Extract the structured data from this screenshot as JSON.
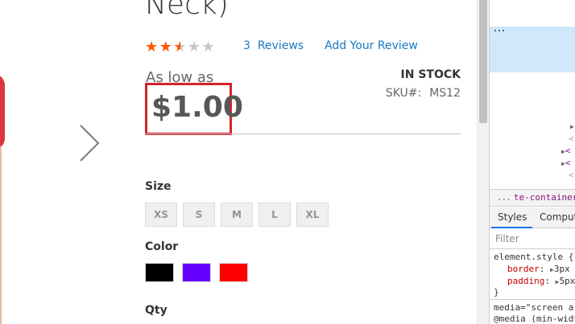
{
  "product": {
    "title": "Neck)",
    "rating": {
      "filled": 2,
      "half": 1,
      "total": 5
    },
    "reviews_count": "3",
    "reviews_label": "Reviews",
    "add_review": "Add Your Review",
    "as_low_as": "As low as",
    "price": "$1.00",
    "stock": "IN STOCK",
    "sku_label": "SKU#:",
    "sku_value": "MS12"
  },
  "options": {
    "size_label": "Size",
    "sizes": [
      "XS",
      "S",
      "M",
      "L",
      "XL"
    ],
    "color_label": "Color",
    "colors": [
      "#000000",
      "#6600ff",
      "#ff0000"
    ],
    "qty_label": "Qty"
  },
  "icons": {
    "gallery_next": "chevron-right-icon",
    "star": "star-icon"
  },
  "colors": {
    "accent_link": "#1979c3",
    "star_filled": "#ff5501",
    "highlight_border": "#d6232b",
    "devtools_selection": "#cfe8fc"
  },
  "devtools": {
    "dom_ellipsis": "...",
    "tree_fragments": [
      "<",
      "<",
      "<",
      "<"
    ],
    "breadcrumb_more": "...",
    "breadcrumb_item": "te-container.pr",
    "tabs": [
      "Styles",
      "Computed"
    ],
    "filter_placeholder": "Filter",
    "element_style": "element.style {",
    "props": [
      {
        "name": "border",
        "value": "3px"
      },
      {
        "name": "padding",
        "value": "5px"
      }
    ],
    "close_brace": "}",
    "media_line": "media=\"screen ar",
    "media_query": "@media (min-widt"
  }
}
